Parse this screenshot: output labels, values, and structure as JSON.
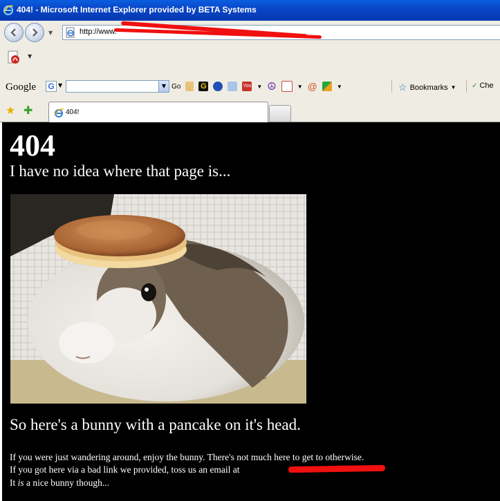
{
  "window": {
    "title": "404! - Microsoft Internet Explorer provided by BETA Systems"
  },
  "address": {
    "url": "http://www."
  },
  "google_toolbar": {
    "logo": "Google",
    "go_label": "Go",
    "bookmarks_label": "Bookmarks",
    "check_label": "Che"
  },
  "tabs": [
    {
      "label": "404!"
    }
  ],
  "page": {
    "heading": "404",
    "subtitle": "I have no idea where that page is...",
    "caption": "So here's a bunny with a pancake on it's head.",
    "line1": "If you were just wandering around, enjoy the bunny. There's not much here to get to otherwise.",
    "line2": "If you got here via a bad link we provided, toss us an email at",
    "line3_pre": "It ",
    "line3_em": "is",
    "line3_post": " a nice bunny though..."
  },
  "colors": {
    "titlebar": "#0846c8",
    "chrome": "#efede3",
    "page_bg": "#000000",
    "redact": "#f01010"
  }
}
